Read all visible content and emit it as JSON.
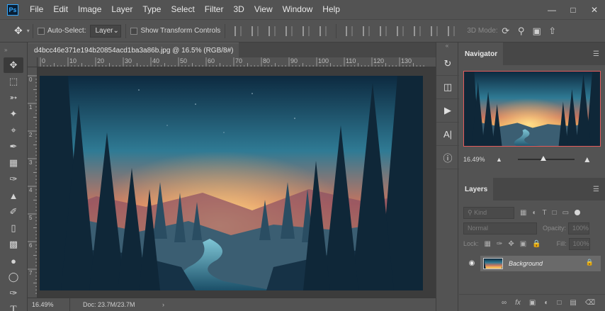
{
  "app": {
    "logo_text": "Ps",
    "menu": [
      "File",
      "Edit",
      "Image",
      "Layer",
      "Type",
      "Select",
      "Filter",
      "3D",
      "View",
      "Window",
      "Help"
    ],
    "window_controls": [
      "—",
      "□",
      "✕"
    ]
  },
  "options": {
    "auto_select_label": "Auto-Select:",
    "auto_select_value": "Layer",
    "show_transform_label": "Show Transform Controls",
    "mode_3d_label": "3D Mode:"
  },
  "document": {
    "tab_title": "d4bcc46e371e194b20854acd1ba3a86b.jpg @ 16.5% (RGB/8#)",
    "close_glyph": "×",
    "ruler_top": [
      "0",
      "10",
      "20",
      "30",
      "40",
      "50",
      "60",
      "70",
      "80",
      "90",
      "100",
      "110",
      "120",
      "130"
    ],
    "ruler_left": [
      "0",
      "1",
      "2",
      "3",
      "4",
      "5",
      "6",
      "7"
    ]
  },
  "status": {
    "zoom": "16.49%",
    "doc_info": "Doc: 23.7M/23.7M",
    "arrow": "›"
  },
  "navigator": {
    "tab_label": "Navigator",
    "zoom": "16.49%",
    "zoom_fraction": 0.45
  },
  "layers": {
    "tab_label": "Layers",
    "kind_placeholder": "Kind",
    "blend_mode": "Normal",
    "opacity_label": "Opacity:",
    "opacity_value": "100%",
    "lock_label": "Lock:",
    "fill_label": "Fill:",
    "fill_value": "100%",
    "items": [
      {
        "name": "Background",
        "locked": true,
        "visible": true
      }
    ]
  },
  "icons": {
    "move": "move-icon",
    "marquee": "rectangular-marquee-icon",
    "lasso": "lasso-icon",
    "magic_wand": "quick-selection-icon",
    "crop": "crop-icon",
    "eyedropper": "eyedropper-icon",
    "healing": "healing-brush-icon",
    "brush": "brush-icon",
    "stamp": "clone-stamp-icon",
    "history": "history-brush-icon",
    "eraser": "eraser-icon",
    "gradient": "gradient-icon",
    "blur": "blur-icon",
    "dodge": "dodge-icon",
    "pen": "pen-icon",
    "type": "type-icon"
  },
  "colors": {
    "accent_nav_border": "#e35b5b",
    "ui_bg": "#535353",
    "panel_dark": "#474747"
  }
}
